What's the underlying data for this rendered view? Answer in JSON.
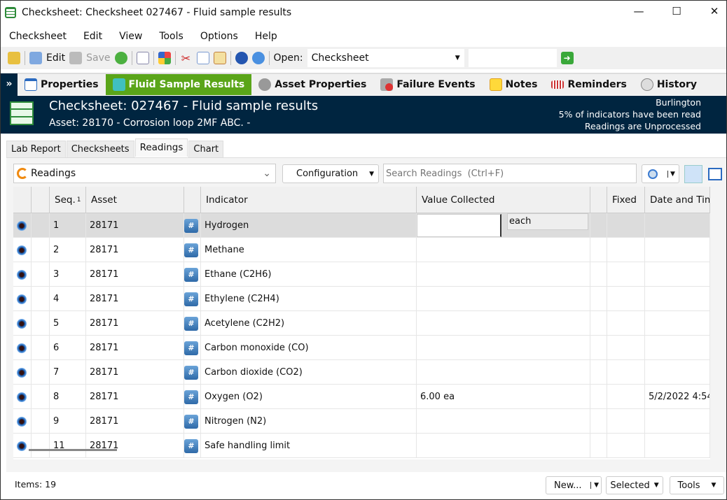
{
  "window": {
    "title": "Checksheet: Checksheet  027467 - Fluid sample results",
    "minimize": "—",
    "maximize": "☐",
    "close": "✕"
  },
  "menu": [
    "Checksheet",
    "Edit",
    "View",
    "Tools",
    "Options",
    "Help"
  ],
  "toolbar": {
    "edit": "Edit",
    "save": "Save",
    "open_label": "Open:",
    "open_value": "Checksheet",
    "search_value": ""
  },
  "nav": [
    "Properties",
    "Fluid Sample Results",
    "Asset Properties",
    "Failure Events",
    "Notes",
    "Reminders",
    "History"
  ],
  "header": {
    "title": "Checksheet: 027467 - Fluid sample results",
    "subtitle": "Asset: 28170 - Corrosion loop 2MF ABC. -",
    "location": "Burlington",
    "progress": "5% of indicators  have been read",
    "status": "Readings are Unprocessed"
  },
  "tabs": [
    "Lab Report",
    "Checksheets",
    "Readings",
    "Chart"
  ],
  "view": {
    "selected": "Readings",
    "configuration": "Configuration",
    "search_placeholder": "Search Readings  (Ctrl+F)"
  },
  "columns": [
    "Seq.",
    "Asset",
    "Indicator",
    "Value Collected",
    "Fixed",
    "Date and Tim"
  ],
  "sort_indicator": "1",
  "edit_unit": "each",
  "rows": [
    {
      "seq": "1",
      "asset": "28171",
      "indicator": "Hydrogen",
      "value": "",
      "date": ""
    },
    {
      "seq": "2",
      "asset": "28171",
      "indicator": "Methane",
      "value": "",
      "date": ""
    },
    {
      "seq": "3",
      "asset": "28171",
      "indicator": "Ethane (C2H6)",
      "value": "",
      "date": ""
    },
    {
      "seq": "4",
      "asset": "28171",
      "indicator": "Ethylene (C2H4)",
      "value": "",
      "date": ""
    },
    {
      "seq": "5",
      "asset": "28171",
      "indicator": "Acetylene (C2H2)",
      "value": "",
      "date": ""
    },
    {
      "seq": "6",
      "asset": "28171",
      "indicator": "Carbon monoxide (CO)",
      "value": "",
      "date": ""
    },
    {
      "seq": "7",
      "asset": "28171",
      "indicator": "Carbon dioxide (CO2)",
      "value": "",
      "date": ""
    },
    {
      "seq": "8",
      "asset": "28171",
      "indicator": "Oxygen (O2)",
      "value": "6.00 ea",
      "date": "5/2/2022 4:54"
    },
    {
      "seq": "9",
      "asset": "28171",
      "indicator": "Nitrogen (N2)",
      "value": "",
      "date": ""
    },
    {
      "seq": "11",
      "asset": "28171",
      "indicator": "Safe handling limit",
      "value": "",
      "date": ""
    }
  ],
  "footer": {
    "items": "Items: 19",
    "new": "New...",
    "selected": "Selected",
    "tools": "Tools"
  }
}
